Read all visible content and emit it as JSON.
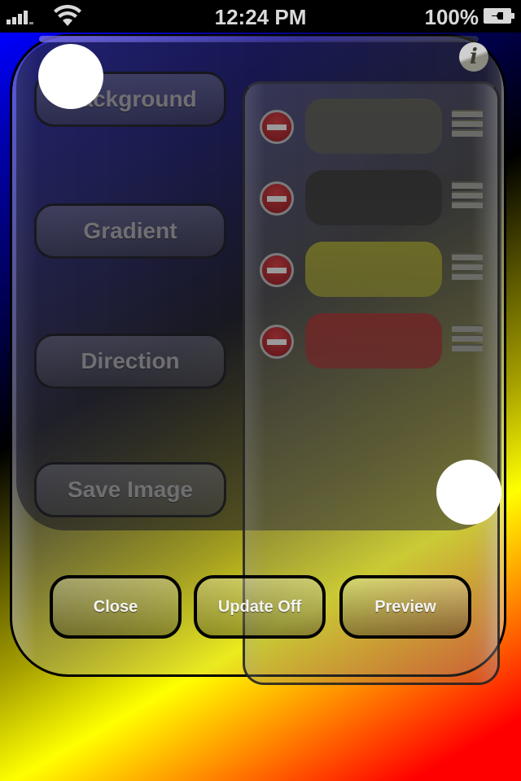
{
  "status_bar": {
    "time": "12:24 PM",
    "battery_percent": "100%",
    "signal_icon": "signal-bars-icon",
    "wifi_icon": "wifi-icon",
    "battery_icon": "battery-charging-icon"
  },
  "side_buttons": [
    {
      "label": "Background"
    },
    {
      "label": "Gradient"
    },
    {
      "label": "Direction"
    },
    {
      "label": "Save Image"
    }
  ],
  "info_button": {
    "glyph": "i",
    "icon": "info-icon"
  },
  "color_list": [
    {
      "color": "#3f3f3c",
      "name": "gray"
    },
    {
      "color": "#2a2a2a",
      "name": "black"
    },
    {
      "color": "#6b6a28",
      "name": "yellow"
    },
    {
      "color": "#6a2a28",
      "name": "red"
    }
  ],
  "bottom_buttons": [
    {
      "label": "Close"
    },
    {
      "label": "Update Off"
    },
    {
      "label": "Preview"
    }
  ],
  "background_gradient": [
    "#0000ff",
    "#000000",
    "#ffff00",
    "#ff0000"
  ]
}
